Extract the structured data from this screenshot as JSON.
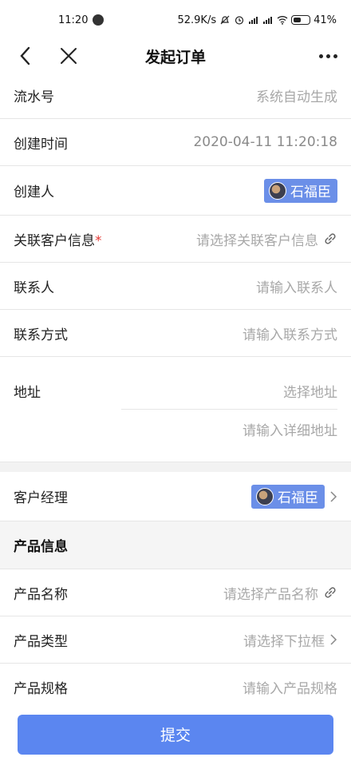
{
  "status_bar": {
    "time": "11:20",
    "network_speed": "52.9K/s",
    "battery": "41%"
  },
  "nav": {
    "title": "发起订单"
  },
  "form": {
    "serial": {
      "label": "流水号",
      "value": "系统自动生成"
    },
    "created_time": {
      "label": "创建时间",
      "value": "2020-04-11 11:20:18"
    },
    "creator": {
      "label": "创建人",
      "value": "石福臣"
    },
    "customer": {
      "label": "关联客户信息",
      "required": "*",
      "placeholder": "请选择关联客户信息"
    },
    "contact": {
      "label": "联系人",
      "placeholder": "请输入联系人"
    },
    "contact_method": {
      "label": "联系方式",
      "placeholder": "请输入联系方式"
    },
    "address": {
      "label": "地址",
      "select_placeholder": "选择地址",
      "detail_placeholder": "请输入详细地址"
    },
    "manager": {
      "label": "客户经理",
      "value": "石福臣"
    }
  },
  "product_section": {
    "header": "产品信息",
    "name": {
      "label": "产品名称",
      "placeholder": "请选择产品名称"
    },
    "type": {
      "label": "产品类型",
      "placeholder": "请选择下拉框"
    },
    "spec": {
      "label": "产品规格",
      "placeholder": "请输入产品规格"
    }
  },
  "submit": {
    "label": "提交"
  },
  "icons": {
    "back": "back-arrow-icon",
    "close": "close-icon",
    "more": "more-icon",
    "link": "link-icon",
    "chevron": "chevron-right-icon"
  },
  "colors": {
    "accent": "#5b86f0",
    "chip": "#6b8fe8",
    "required": "#e53935"
  }
}
